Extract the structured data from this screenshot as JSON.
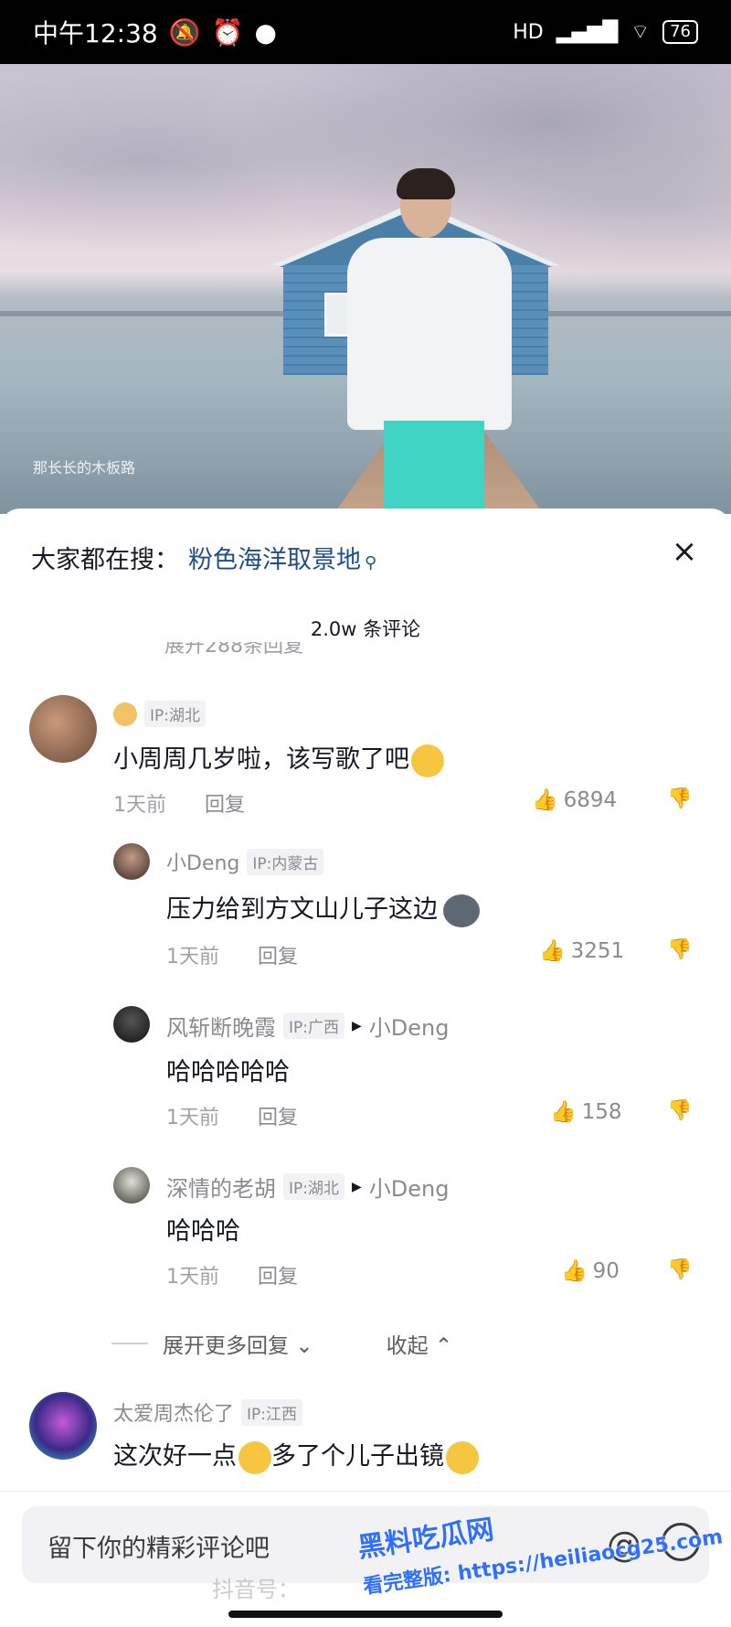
{
  "status_bar": {
    "time": "中午12:38",
    "network": "HD",
    "battery": "76"
  },
  "video": {
    "caption": "那长长的木板路"
  },
  "search_bar": {
    "prefix": "大家都在搜：",
    "term": "粉色海洋取景地",
    "close_label": "×"
  },
  "comment_count": "2.0w 条评论",
  "partial_text": "展开288条回复",
  "comments": [
    {
      "username": "",
      "ip": "IP:湖北",
      "text": "小周周几岁啦，该写歌了吧",
      "time": "1天前",
      "reply_label": "回复",
      "likes": "6894",
      "emoji": "crying-laughing"
    },
    {
      "username": "小Deng",
      "ip": "IP:内蒙古",
      "text": "压力给到方文山儿子这边",
      "time": "1天前",
      "reply_label": "回复",
      "likes": "3251",
      "emoji": "husky"
    },
    {
      "username": "风斩断晚霞",
      "ip": "IP:广西",
      "reply_to": "小Deng",
      "text": "哈哈哈哈哈",
      "time": "1天前",
      "reply_label": "回复",
      "likes": "158"
    },
    {
      "username": "深情的老胡",
      "ip": "IP:湖北",
      "reply_to": "小Deng",
      "text": "哈哈哈",
      "time": "1天前",
      "reply_label": "回复",
      "likes": "90"
    },
    {
      "username": "太爱周杰伦了",
      "ip": "IP:江西",
      "text_parts": [
        "这次好一点",
        "多了个儿子出镜"
      ]
    }
  ],
  "expand_more": "展开更多回复",
  "collapse": "收起",
  "input": {
    "placeholder": "留下你的精彩评论吧"
  },
  "watermark": {
    "title": "黑料吃瓜网",
    "url": "看完整版: https://heiliaocg25.com",
    "doushu": "抖音号："
  },
  "colors": {
    "link": "#1f4e8c",
    "watermark": "#2f6fff"
  }
}
